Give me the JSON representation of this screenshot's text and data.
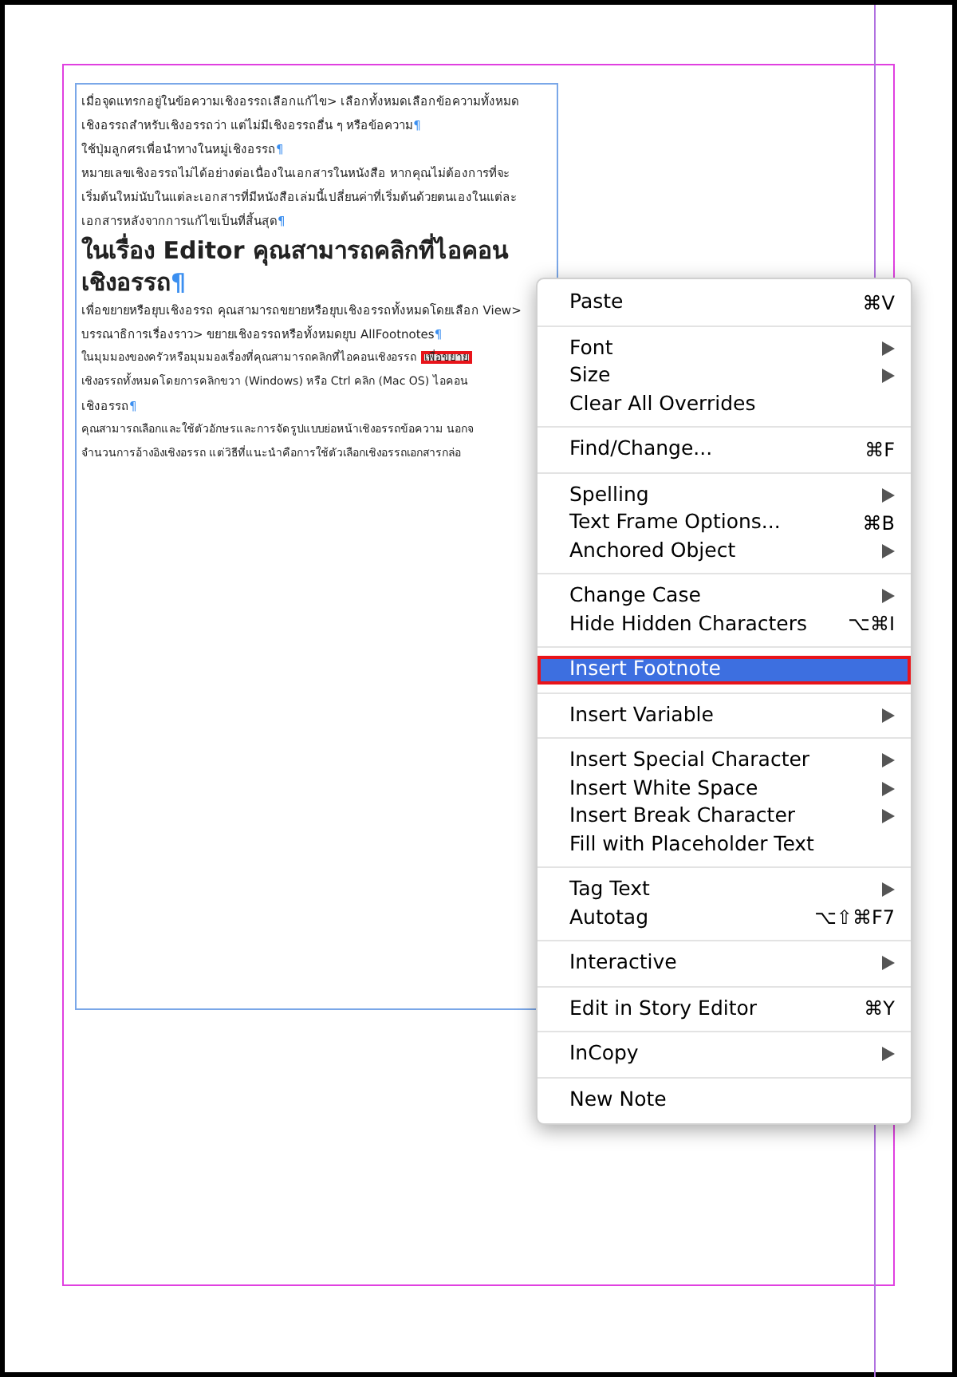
{
  "document": {
    "paragraphs": [
      {
        "kind": "body",
        "segments": [
          {
            "text": "เมื่อจุดแทรกอยู่ในข้อความเชิงอรรถเลือกแก้ไข> เลือกทั้งหมดเลือกข้อความทั้งหมดเชิงอรรถสำหรับเชิงอรรถว่า แต่ไม่มีเชิงอรรถอื่น ๆ หรือข้อความ",
            "marked": false
          }
        ],
        "end_mark": "¶"
      },
      {
        "kind": "body",
        "segments": [
          {
            "text": "ใช้ปุ่มลูกศรเพื่อนำทางในหมู่เชิงอรรถ",
            "marked": false
          }
        ],
        "end_mark": "¶"
      },
      {
        "kind": "body",
        "segments": [
          {
            "text": "หมายเลขเชิงอรรถไม่ได้อย่างต่อเนื่องในเอกสารในหนังสือ หากคุณไม่ต้องการที่จะเริ่มต้นใหม่นับในแต่ละเอกสารที่มีหนังสือเล่มนี้เปลี่ยนค่าที่เริ่มต้นด้วยตนเองในแต่ละเอกสารหลังจากการแก้ไขเป็นที่สิ้นสุด",
            "marked": false
          }
        ],
        "end_mark": "¶"
      },
      {
        "kind": "heading",
        "segments": [
          {
            "text": "ในเรื่อง Editor คุณสามารถคลิกที่ไอคอนเชิงอรรถ",
            "marked": false
          }
        ],
        "end_mark": "¶"
      },
      {
        "kind": "body",
        "segments": [
          {
            "text": "เพื่อขยายหรือยุบเชิงอรรถ คุณสามารถขยายหรือยุบเชิงอรรถทั้งหมดโดยเลือก View> บรรณาธิการเรื่องราว> ขยายเชิงอรรถหรือทั้งหมดยุบ AllFootnotes",
            "marked": false
          }
        ],
        "end_mark": "¶"
      },
      {
        "kind": "clipped",
        "segments": [
          {
            "text": "ในมุมมองของครัวหรือมุมมองเรื่องที่คุณสามารถคลิกที่ไอคอนเชิงอรรถ",
            "marked": false
          },
          {
            "text": "เพื่อขยาย",
            "marked": true
          }
        ]
      },
      {
        "kind": "clipped",
        "segments": [
          {
            "text": "เชิงอรรถทั้งหมดโดยการคลิกขวา (Windows) หรือ Ctrl คลิก (Mac OS) ไอคอน",
            "marked": false
          }
        ]
      },
      {
        "kind": "body",
        "segments": [
          {
            "text": "เชิงอรรถ",
            "marked": false
          }
        ],
        "end_mark": "¶"
      },
      {
        "kind": "clipped",
        "segments": [
          {
            "text": "คุณสามารถเลือกและใช้ตัวอักษรและการจัดรูปแบบย่อหน้าเชิงอรรถข้อความ นอกจ",
            "marked": false
          }
        ]
      },
      {
        "kind": "clipped",
        "segments": [
          {
            "text": "จำนวนการอ้างอิงเชิงอรรถ แต่วิธีที่แนะนำคือการใช้ตัวเลือกเชิงอรรถเอกสารกล่อ",
            "marked": false
          }
        ]
      }
    ]
  },
  "context_menu": {
    "groups": [
      {
        "items": [
          {
            "label": "Paste",
            "shortcut": "⌘V",
            "submenu": false,
            "selected": false,
            "annotated": false
          }
        ]
      },
      {
        "items": [
          {
            "label": "Font",
            "submenu": true,
            "selected": false,
            "annotated": false
          },
          {
            "label": "Size",
            "submenu": true,
            "selected": false,
            "annotated": false
          },
          {
            "label": "Clear All Overrides",
            "submenu": false,
            "selected": false,
            "annotated": false
          }
        ]
      },
      {
        "items": [
          {
            "label": "Find/Change...",
            "shortcut": "⌘F",
            "submenu": false,
            "selected": false,
            "annotated": false
          }
        ]
      },
      {
        "items": [
          {
            "label": "Spelling",
            "submenu": true,
            "selected": false,
            "annotated": false
          },
          {
            "label": "Text Frame Options...",
            "shortcut": "⌘B",
            "submenu": false,
            "selected": false,
            "annotated": false
          },
          {
            "label": "Anchored Object",
            "submenu": true,
            "selected": false,
            "annotated": false
          }
        ]
      },
      {
        "items": [
          {
            "label": "Change Case",
            "submenu": true,
            "selected": false,
            "annotated": false
          },
          {
            "label": "Hide Hidden Characters",
            "shortcut": "⌥⌘I",
            "submenu": false,
            "selected": false,
            "annotated": false
          }
        ]
      },
      {
        "items": [
          {
            "label": "Insert Footnote",
            "submenu": false,
            "selected": true,
            "annotated": true
          }
        ]
      },
      {
        "items": [
          {
            "label": "Insert Variable",
            "submenu": true,
            "selected": false,
            "annotated": false
          }
        ]
      },
      {
        "items": [
          {
            "label": "Insert Special Character",
            "submenu": true,
            "selected": false,
            "annotated": false
          },
          {
            "label": "Insert White Space",
            "submenu": true,
            "selected": false,
            "annotated": false
          },
          {
            "label": "Insert Break Character",
            "submenu": true,
            "selected": false,
            "annotated": false
          },
          {
            "label": "Fill with Placeholder Text",
            "submenu": false,
            "selected": false,
            "annotated": false
          }
        ]
      },
      {
        "items": [
          {
            "label": "Tag Text",
            "submenu": true,
            "selected": false,
            "annotated": false
          },
          {
            "label": "Autotag",
            "shortcut": "⌥⇧⌘F7",
            "submenu": false,
            "selected": false,
            "annotated": false
          }
        ]
      },
      {
        "items": [
          {
            "label": "Interactive",
            "submenu": true,
            "selected": false,
            "annotated": false
          }
        ]
      },
      {
        "items": [
          {
            "label": "Edit in Story Editor",
            "shortcut": "⌘Y",
            "submenu": false,
            "selected": false,
            "annotated": false
          }
        ]
      },
      {
        "items": [
          {
            "label": "InCopy",
            "submenu": true,
            "selected": false,
            "annotated": false
          }
        ]
      },
      {
        "items": [
          {
            "label": "New Note",
            "submenu": false,
            "selected": false,
            "annotated": false
          }
        ]
      }
    ]
  }
}
